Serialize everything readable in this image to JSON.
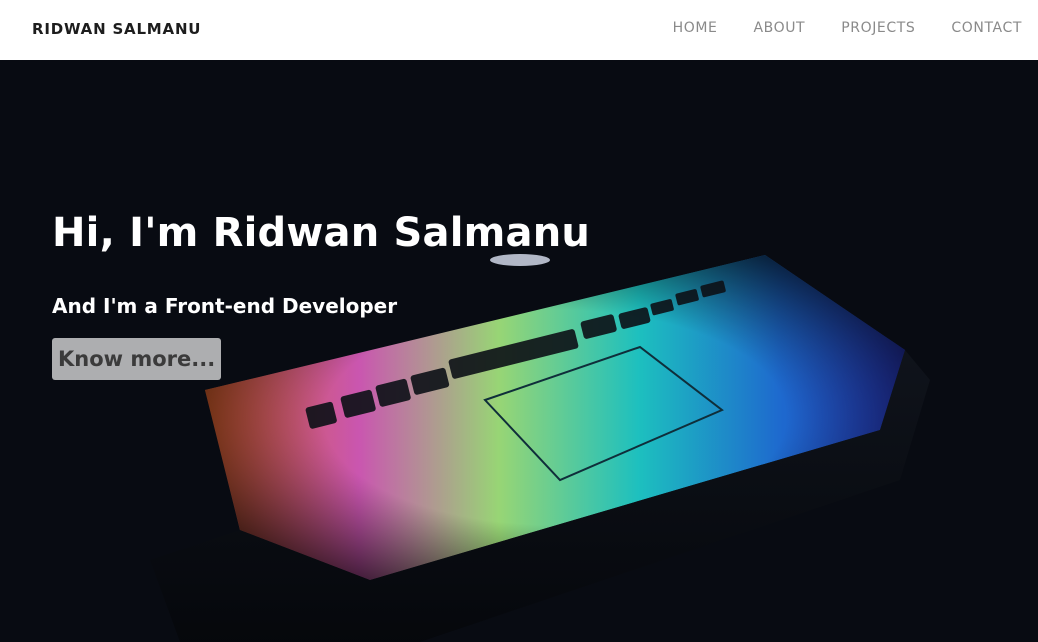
{
  "header": {
    "brand": "RIDWAN SALMANU",
    "nav": [
      {
        "label": "HOME"
      },
      {
        "label": "ABOUT"
      },
      {
        "label": "PROJECTS"
      },
      {
        "label": "CONTACT"
      }
    ]
  },
  "hero": {
    "headline": "Hi, I'm Ridwan Salmanu",
    "subheadline": "And I'm a Front-end Developer",
    "cta_label": "Know more...",
    "background_image": "laptop-keyboard-rainbow-glow"
  },
  "colors": {
    "nav_bg": "#ffffff",
    "brand_text": "#1d1d1d",
    "nav_link": "#8a8a8a",
    "hero_bg": "#080b12",
    "hero_text": "#ffffff",
    "cta_bg": "#d6d6d6"
  }
}
